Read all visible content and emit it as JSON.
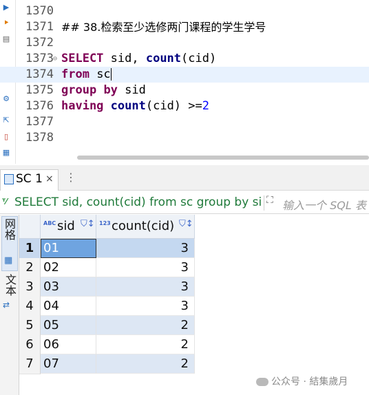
{
  "editor": {
    "lines": [
      {
        "num": "1370",
        "text": ""
      },
      {
        "num": "1371",
        "text": "## 38.检索至少选修两门课程的学生学号"
      },
      {
        "num": "1372",
        "text": ""
      },
      {
        "num": "1373",
        "text": "SELECT sid, count(cid)"
      },
      {
        "num": "1374",
        "text": "from sc"
      },
      {
        "num": "1375",
        "text": "group by sid"
      },
      {
        "num": "1376",
        "text": "having count(cid) >=2"
      },
      {
        "num": "1377",
        "text": ""
      },
      {
        "num": "1378",
        "text": ""
      }
    ],
    "tokens": {
      "l1371_cmt": "## 38.检索至少选修两门课程的学生学号",
      "l1373_kw": "SELECT",
      "l1373_a": " sid, ",
      "l1373_fn": "count",
      "l1373_b": "(cid)",
      "l1374_kw": "from",
      "l1374_a": " sc",
      "l1375_kw1": "group",
      "l1375_kw2": "by",
      "l1375_a": " sid",
      "l1376_kw": "having",
      "l1376_fn": "count",
      "l1376_a": "(cid) >=",
      "l1376_num": "2"
    },
    "fold_marker": "⊖"
  },
  "results_tab": {
    "title": "SC 1",
    "close": "×"
  },
  "filter": {
    "sql": "SELECT sid, count(cid) from sc group by sid",
    "placeholder": "输入一个 SQL 表"
  },
  "side_panel": {
    "grid_label": "网格",
    "text_label": "文本"
  },
  "grid": {
    "columns": [
      {
        "type_badge": "ABC",
        "name": "sid"
      },
      {
        "type_badge": "123",
        "name": "count(cid)"
      }
    ],
    "rows": [
      {
        "num": "1",
        "sid": "01",
        "count": "3"
      },
      {
        "num": "2",
        "sid": "02",
        "count": "3"
      },
      {
        "num": "3",
        "sid": "03",
        "count": "3"
      },
      {
        "num": "4",
        "sid": "04",
        "count": "3"
      },
      {
        "num": "5",
        "sid": "05",
        "count": "2"
      },
      {
        "num": "6",
        "sid": "06",
        "count": "2"
      },
      {
        "num": "7",
        "sid": "07",
        "count": "2"
      }
    ]
  },
  "watermark": "公众号 · 結集歲月",
  "colors": {
    "keyword": "#7f0055",
    "function": "#00007f",
    "number": "#0000ff",
    "filter_sql": "#1f7a3a",
    "selection": "#6fa4e0"
  }
}
